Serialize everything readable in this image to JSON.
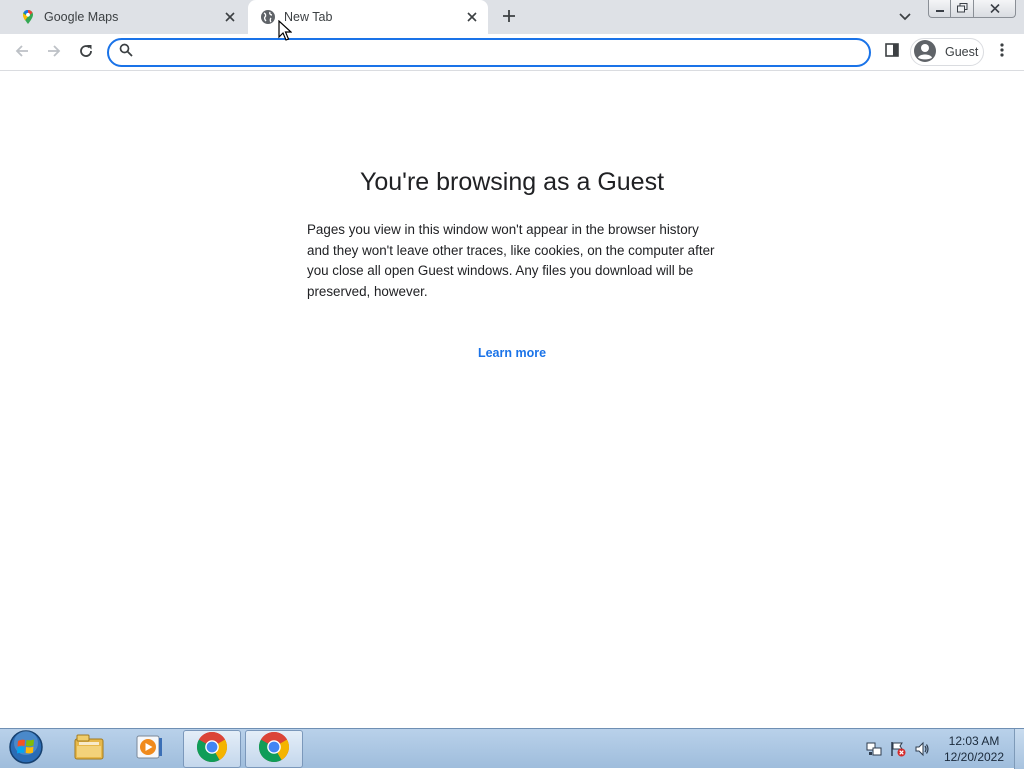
{
  "tabs": [
    {
      "title": "Google Maps",
      "icon": "google-maps-pin-icon",
      "active": false
    },
    {
      "title": "New Tab",
      "icon": "globe-icon",
      "active": true
    }
  ],
  "toolbar": {
    "omnibox_value": "",
    "omnibox_placeholder": "",
    "profile_label": "Guest"
  },
  "content": {
    "heading": "You're browsing as a Guest",
    "body": "Pages you view in this window won't appear in the browser history and they won't leave other traces, like cookies, on the computer after you close all open Guest windows. Any files you download will be preserved, however.",
    "learn_more": "Learn more"
  },
  "taskbar": {
    "items": [
      "start-orb",
      "file-explorer",
      "media-player",
      "chrome",
      "chrome"
    ],
    "time": "12:03 AM",
    "date": "12/20/2022"
  },
  "colors": {
    "accent": "#1a73e8",
    "tabstrip": "#dee1e6",
    "taskbar": "#b9d1ea"
  }
}
